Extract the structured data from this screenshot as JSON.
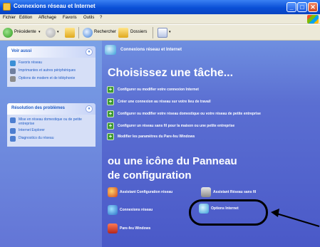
{
  "window": {
    "title": "Connexions réseau et Internet",
    "controls": {
      "minimize": "_",
      "maximize": "□",
      "close": "✕"
    }
  },
  "menu": [
    "Fichier",
    "Edition",
    "Affichage",
    "Favoris",
    "Outils",
    "?"
  ],
  "toolbar": {
    "back_label": "Précédente",
    "search_label": "Rechercher",
    "folders_label": "Dossiers"
  },
  "left_panel": {
    "see_also": {
      "title": "Voir aussi",
      "chevron": "«",
      "items": [
        "Favoris réseau",
        "Imprimantes et autres périphériques",
        "Options de modem et de téléphonie"
      ]
    },
    "troubleshooting": {
      "title": "Résolution des problèmes",
      "chevron": "«",
      "items": [
        "Mise en réseau domestique ou de petite entreprise",
        "Internet Explorer",
        "Diagnostics du réseau"
      ]
    }
  },
  "main": {
    "header_title": "Connexions réseau et Internet",
    "task_heading": "Choisissez une tâche...",
    "plus_glyph": "+",
    "tasks": [
      "Configurer ou modifier votre connexion Internet",
      "Créer une connexion au réseau sur votre lieu de travail",
      "Configurer ou modifier votre réseau domestique ou votre réseau de petite entreprise",
      "Configurer un réseau sans fil pour la maison ou une petite entreprise",
      "Modifier les paramètres du Pare-feu Windows"
    ],
    "or_heading": "ou une icône du Panneau de configuration",
    "control_panel_icons": [
      {
        "label": "Assistant Configuration réseau",
        "icon": "network-setup-icon"
      },
      {
        "label": "Assistant Réseau sans fil",
        "icon": "wireless-icon"
      },
      {
        "label": "Connexions réseau",
        "icon": "network-connections-icon"
      },
      {
        "label": "Options Internet",
        "icon": "internet-options-icon"
      },
      {
        "label": "Pare-feu Windows",
        "icon": "firewall-icon"
      }
    ]
  },
  "colors": {
    "title_bar": "#0a4fd6",
    "main_bg": "#5b6fd2",
    "left_panel_bg": "#7aa1e6",
    "task_plus": "#3f9a30",
    "link_text": "#215dc6"
  }
}
